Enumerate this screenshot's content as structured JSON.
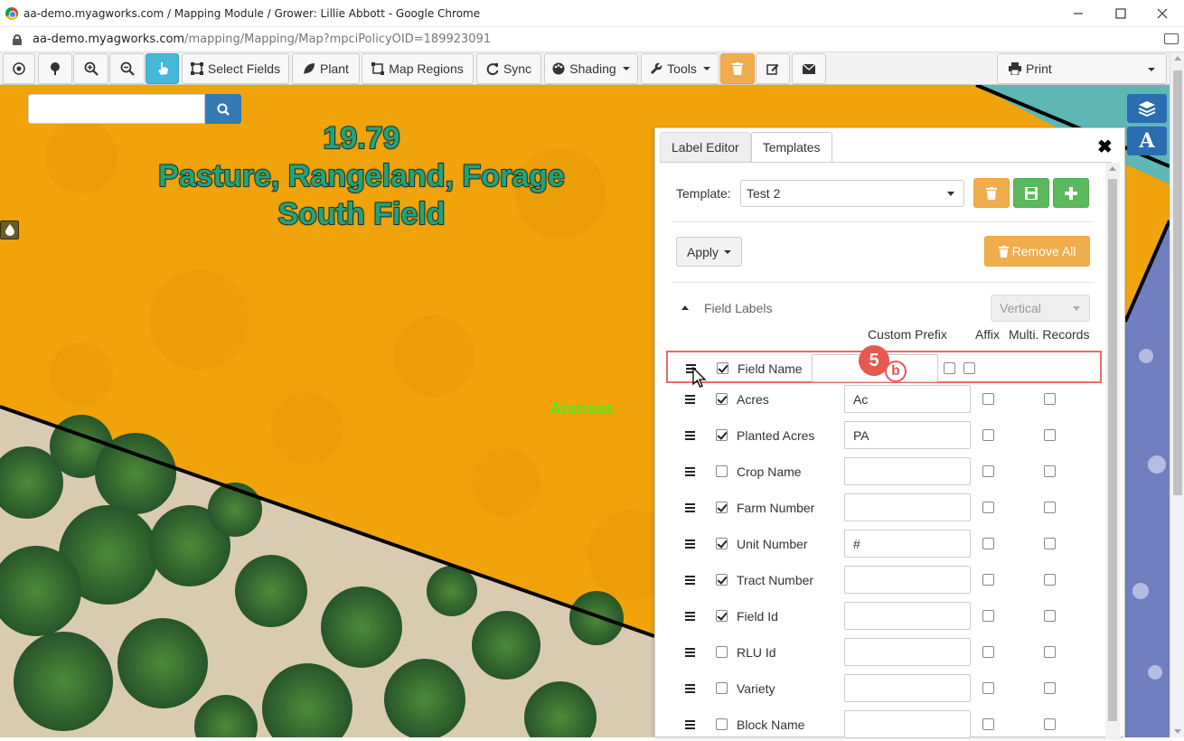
{
  "window": {
    "title": "aa-demo.myagworks.com / Mapping Module / Grower: Lillie Abbott - Google Chrome",
    "url_host": "aa-demo.myagworks.com",
    "url_path": "/mapping/Mapping/Map?mpciPolicyOID=189923091"
  },
  "toolbar": {
    "select_fields": "Select Fields",
    "plant": "Plant",
    "map_regions": "Map Regions",
    "sync": "Sync",
    "shading": "Shading",
    "tools": "Tools",
    "print": "Print"
  },
  "map": {
    "search_placeholder": "",
    "field_label_acres": "19.79",
    "field_label_crop": "Pasture, Rangeland, Forage",
    "field_label_name": "South Field",
    "county_label": "Aransas",
    "label_button": "A"
  },
  "panel": {
    "tabs": [
      "Label Editor",
      "Templates"
    ],
    "active_tab": "Templates",
    "template_label": "Template:",
    "template_value": "Test 2",
    "apply_label": "Apply",
    "remove_all_label": "Remove All",
    "section_title": "Field Labels",
    "orientation_value": "Vertical",
    "col_custom_prefix": "Custom Prefix",
    "col_affix": "Affix",
    "col_multi_records": "Multi. Records",
    "rows": [
      {
        "label": "Field Name",
        "enabled": true,
        "prefix": "",
        "affix": false,
        "multi": false
      },
      {
        "label": "Acres",
        "enabled": true,
        "prefix": "Ac",
        "affix": false,
        "multi": false
      },
      {
        "label": "Planted Acres",
        "enabled": true,
        "prefix": "PA",
        "affix": false,
        "multi": false
      },
      {
        "label": "Crop Name",
        "enabled": false,
        "prefix": "",
        "affix": false,
        "multi": false
      },
      {
        "label": "Farm Number",
        "enabled": true,
        "prefix": "",
        "affix": false,
        "multi": false
      },
      {
        "label": "Unit Number",
        "enabled": true,
        "prefix": "#",
        "affix": false,
        "multi": false
      },
      {
        "label": "Tract Number",
        "enabled": true,
        "prefix": "",
        "affix": false,
        "multi": false
      },
      {
        "label": "Field Id",
        "enabled": true,
        "prefix": "",
        "affix": false,
        "multi": false
      },
      {
        "label": "RLU Id",
        "enabled": false,
        "prefix": "",
        "affix": false,
        "multi": false
      },
      {
        "label": "Variety",
        "enabled": false,
        "prefix": "",
        "affix": false,
        "multi": false
      },
      {
        "label": "Block Name",
        "enabled": false,
        "prefix": "",
        "affix": false,
        "multi": false
      }
    ]
  },
  "annotation": {
    "step_number": "5",
    "step_sub": "b"
  },
  "colors": {
    "field_fill": "#f0a30a",
    "primary_blue": "#337ab7",
    "warning_orange": "#f0ad4e",
    "success_green": "#5cb85c",
    "highlight_red": "#e96b6b"
  }
}
